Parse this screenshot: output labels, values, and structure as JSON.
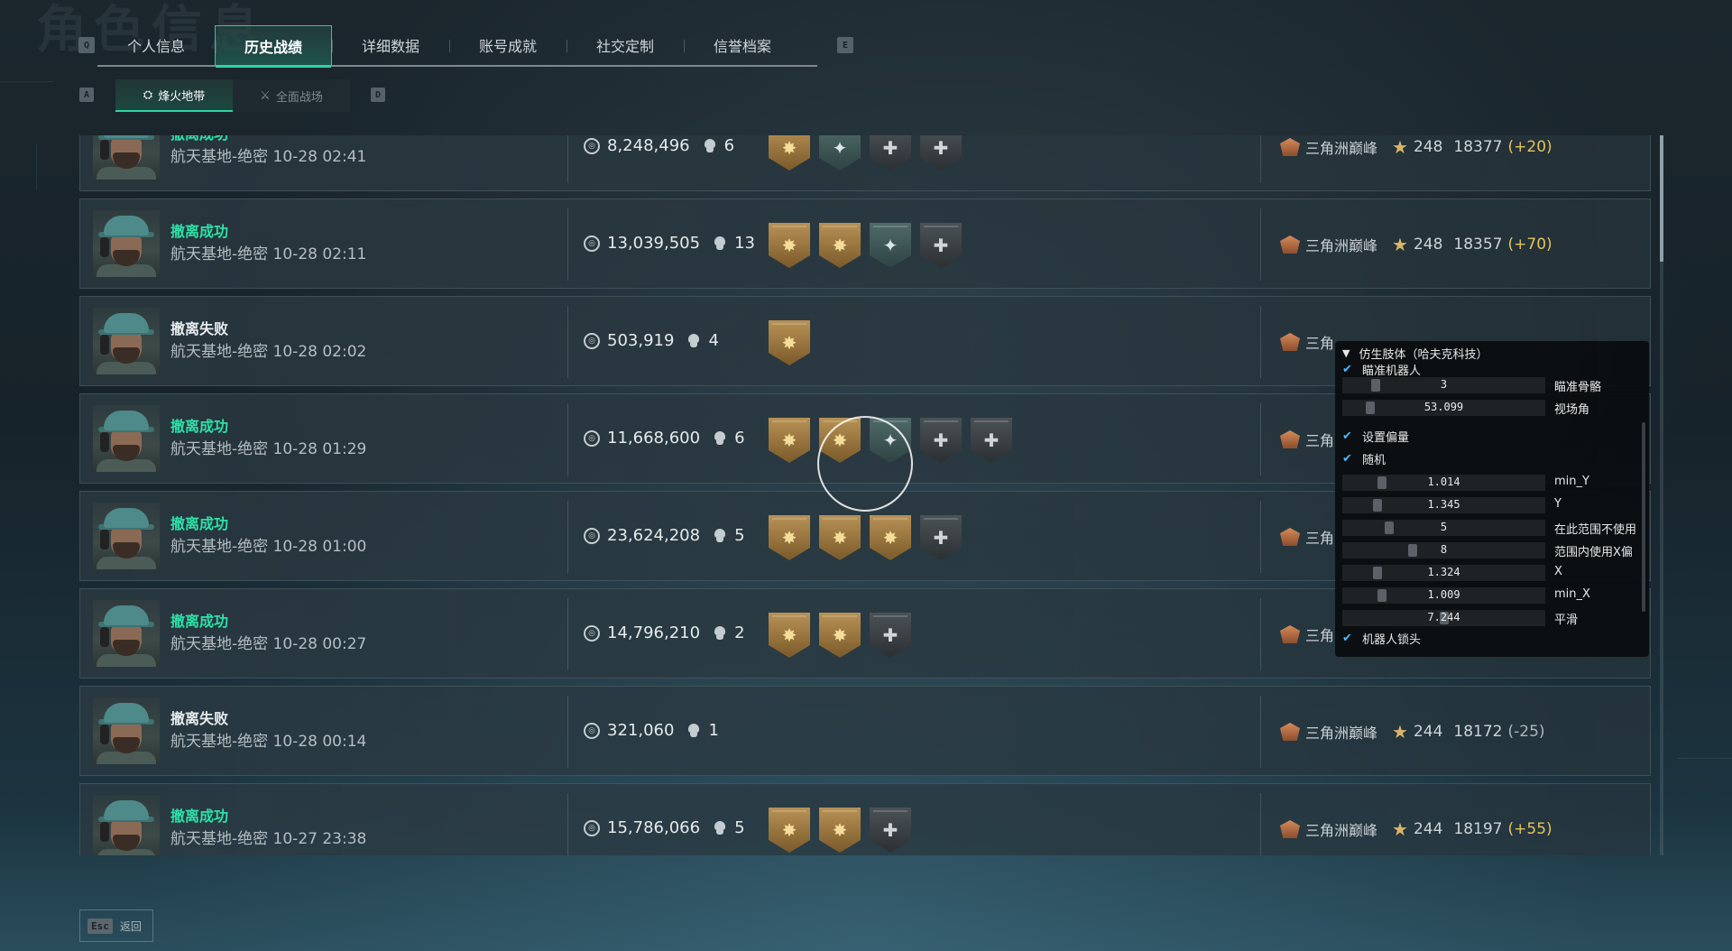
{
  "background_title": "角色信息",
  "hotkeys": {
    "prev_tab": "Q",
    "next_tab": "E",
    "prev_sub": "A",
    "next_sub": "D"
  },
  "tabs": [
    {
      "label": "个人信息",
      "active": false
    },
    {
      "label": "历史战绩",
      "active": true
    },
    {
      "label": "详细数据",
      "active": false
    },
    {
      "label": "账号成就",
      "active": false
    },
    {
      "label": "社交定制",
      "active": false
    },
    {
      "label": "信誉档案",
      "active": false
    }
  ],
  "subtabs": [
    {
      "label": "烽火地带",
      "icon": "hazard-zone-icon",
      "active": true
    },
    {
      "label": "全面战场",
      "icon": "battlefield-icon",
      "active": false
    }
  ],
  "records": [
    {
      "status": "撤离成功",
      "ok": true,
      "map": "航天基地-绝密",
      "time": "10-28 02:41",
      "value": "8,248,496",
      "kills": "6",
      "badges": [
        "gold",
        "teal",
        "gray",
        "gray"
      ],
      "rank": "三角洲巅峰",
      "level": "248",
      "score": "18377",
      "delta": "(+20)",
      "delta_pos": true
    },
    {
      "status": "撤离成功",
      "ok": true,
      "map": "航天基地-绝密",
      "time": "10-28 02:11",
      "value": "13,039,505",
      "kills": "13",
      "badges": [
        "gold",
        "gold",
        "teal",
        "gray"
      ],
      "rank": "三角洲巅峰",
      "level": "248",
      "score": "18357",
      "delta": "(+70)",
      "delta_pos": true
    },
    {
      "status": "撤离失败",
      "ok": false,
      "map": "航天基地-绝密",
      "time": "10-28 02:02",
      "value": "503,919",
      "kills": "4",
      "badges": [
        "gold"
      ],
      "rank": "三角",
      "level": "",
      "score": "",
      "delta": "",
      "delta_pos": true
    },
    {
      "status": "撤离成功",
      "ok": true,
      "map": "航天基地-绝密",
      "time": "10-28 01:29",
      "value": "11,668,600",
      "kills": "6",
      "badges": [
        "gold",
        "gold",
        "teal",
        "gray",
        "gray"
      ],
      "rank": "三角",
      "level": "",
      "score": "",
      "delta": "",
      "delta_pos": true
    },
    {
      "status": "撤离成功",
      "ok": true,
      "map": "航天基地-绝密",
      "time": "10-28 01:00",
      "value": "23,624,208",
      "kills": "5",
      "badges": [
        "gold",
        "gold",
        "gold",
        "gray"
      ],
      "rank": "三角",
      "level": "",
      "score": "",
      "delta": "",
      "delta_pos": true
    },
    {
      "status": "撤离成功",
      "ok": true,
      "map": "航天基地-绝密",
      "time": "10-28 00:27",
      "value": "14,796,210",
      "kills": "2",
      "badges": [
        "gold",
        "gold",
        "gray"
      ],
      "rank": "三角",
      "level": "",
      "score": "",
      "delta": "",
      "delta_pos": true
    },
    {
      "status": "撤离失败",
      "ok": false,
      "map": "航天基地-绝密",
      "time": "10-28 00:14",
      "value": "321,060",
      "kills": "1",
      "badges": [],
      "rank": "三角洲巅峰",
      "level": "244",
      "score": "18172",
      "delta": "(-25)",
      "delta_pos": false
    },
    {
      "status": "撤离成功",
      "ok": true,
      "map": "航天基地-绝密",
      "time": "10-27 23:38",
      "value": "15,786,066",
      "kills": "5",
      "badges": [
        "gold",
        "gold",
        "gray"
      ],
      "rank": "三角洲巅峰",
      "level": "244",
      "score": "18197",
      "delta": "(+55)",
      "delta_pos": true
    }
  ],
  "overlay": {
    "header": "仿生肢体（哈夫克科技）",
    "checks": [
      {
        "label": "瞄准机器人",
        "checked": true
      },
      {
        "label": "设置偏量",
        "checked": true
      },
      {
        "label": "随机",
        "checked": true
      },
      {
        "label": "机器人锁头",
        "checked": true
      }
    ],
    "sliders": [
      {
        "value": "3",
        "label": "瞄准骨骼",
        "level": 0.15
      },
      {
        "value": "53.099",
        "label": "视场角",
        "level": 0.12
      },
      {
        "value": "1.014",
        "label": "min_Y",
        "level": 0.18
      },
      {
        "value": "1.345",
        "label": "Y",
        "level": 0.16
      },
      {
        "value": "5",
        "label": "在此范围不使用",
        "level": 0.22
      },
      {
        "value": "8",
        "label": "范围内使用X偏",
        "level": 0.34
      },
      {
        "value": "1.324",
        "label": "X",
        "level": 0.16
      },
      {
        "value": "1.009",
        "label": "min_X",
        "level": 0.18
      },
      {
        "value": "7.244",
        "label": "平滑",
        "level": 0.5
      }
    ]
  },
  "footer": {
    "esc_key": "Esc",
    "back_label": "返回"
  }
}
